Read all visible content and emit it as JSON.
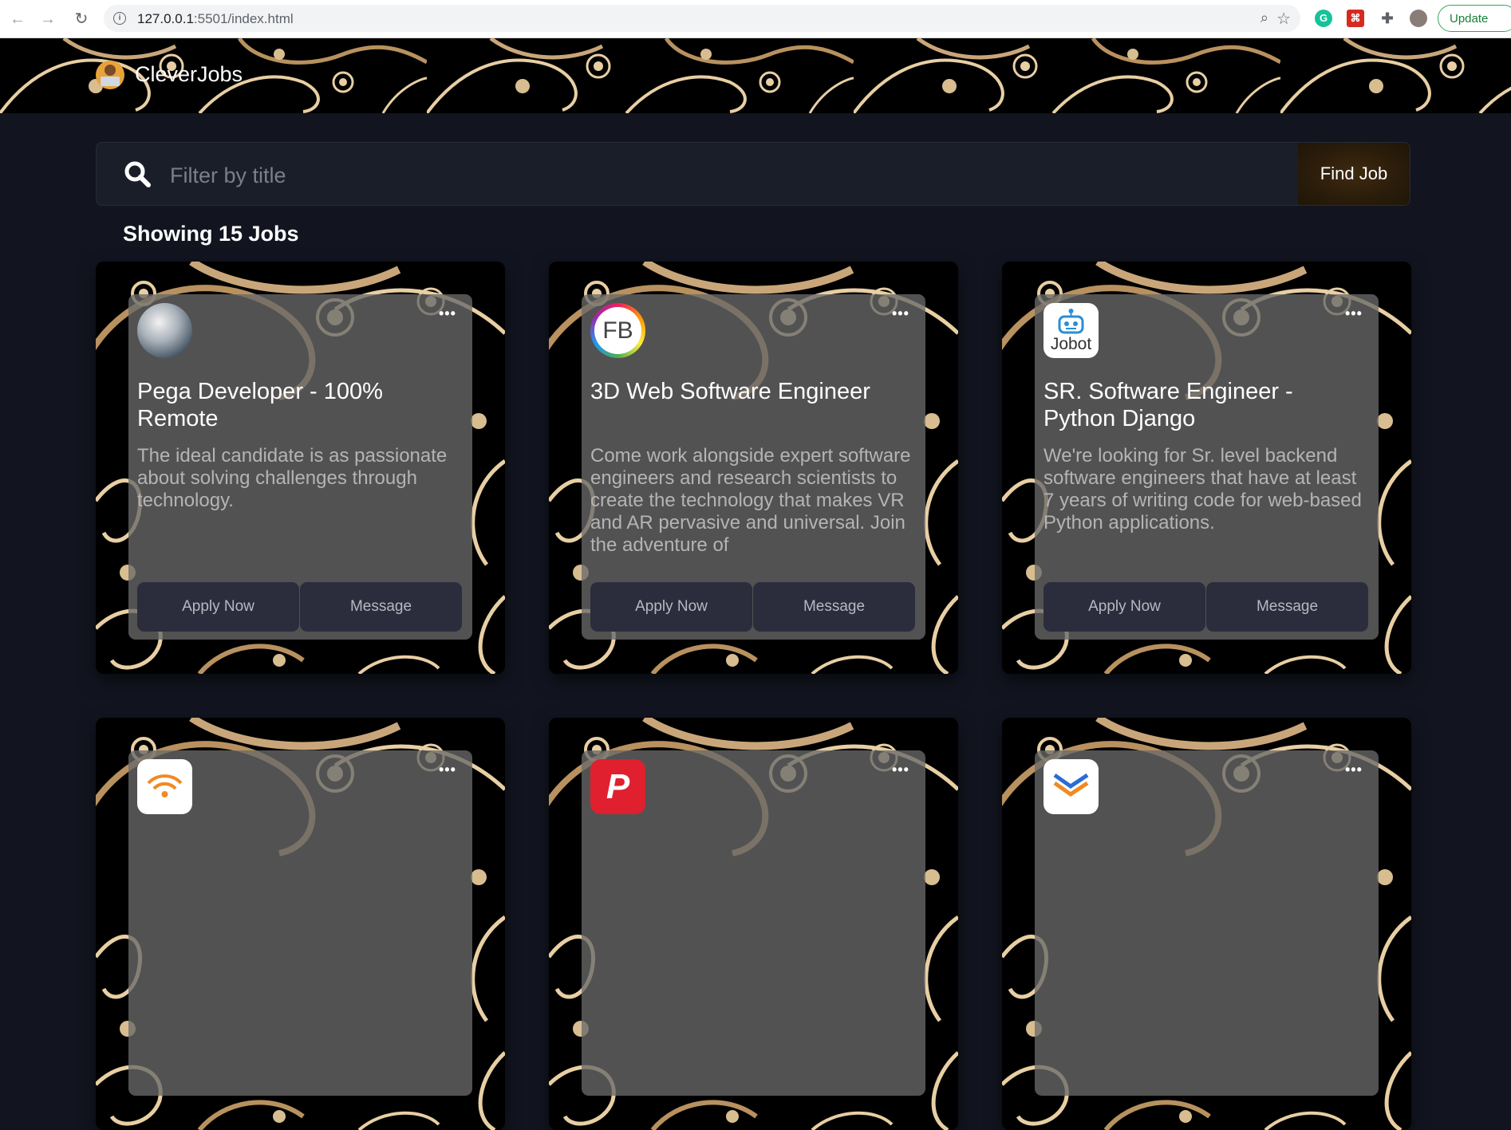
{
  "browser": {
    "url_host": "127.0.0.1",
    "url_rest": ":5501/index.html",
    "update_label": "Update"
  },
  "header": {
    "brand": "CleverJobs"
  },
  "search": {
    "placeholder": "Filter by title",
    "button_label": "Find Job"
  },
  "count_text": "Showing 15 Jobs",
  "jobs": [
    {
      "logo": "pega-swirl-logo",
      "title": "Pega Developer - 100% Remote",
      "description": "The ideal candidate is as passionate about solving challenges through technology.",
      "apply_label": "Apply Now",
      "message_label": "Message"
    },
    {
      "logo_text": "FB",
      "title": "3D Web Software Engineer",
      "description": "Come work alongside expert software engineers and research scientists to create the technology that makes VR and AR pervasive and universal. Join the adventure of",
      "apply_label": "Apply Now",
      "message_label": "Message"
    },
    {
      "logo_text": "Jobot",
      "title": "SR. Software Engineer - Python Django",
      "description": "We're looking for Sr. level backend software engineers that have at least 7 years of writing code for web-based Python applications.",
      "apply_label": "Apply Now",
      "message_label": "Message"
    },
    {
      "logo": "wifi-orange-logo"
    },
    {
      "logo_text": "P"
    },
    {
      "logo": "chevron-logo"
    }
  ],
  "colors": {
    "page_bg": "#121520",
    "card_panel": "#696969",
    "button_bg": "#2b2d3d",
    "find_btn": "#3e2a10",
    "ornament": "#e8cfa3"
  }
}
